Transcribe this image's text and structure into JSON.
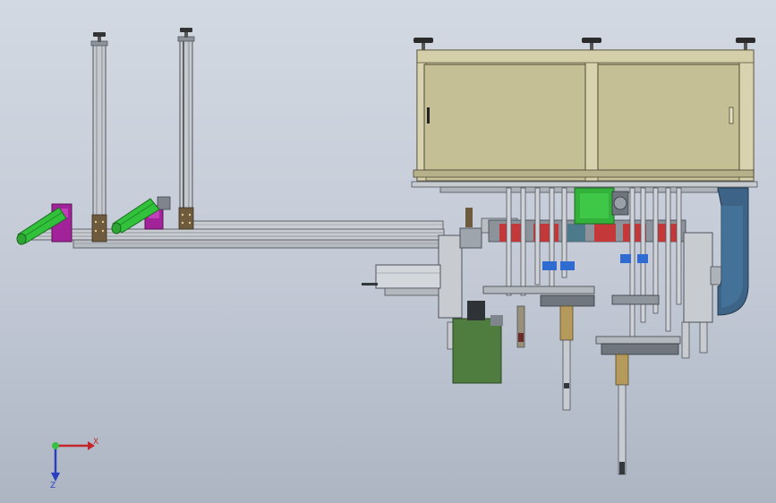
{
  "viewport": {
    "background_top": "#d3d9e2",
    "background_bottom": "#adb5c3"
  },
  "colors": {
    "frame": "#c9cdd2",
    "frame_dark": "#6f757c",
    "cabinet": "#c9c39a",
    "cabinet_dark": "#8a8463",
    "conveyor_green": "#31c13a",
    "magenta_block": "#a2229a",
    "blue_chute": "#3d6486",
    "dark_green_box": "#4f7d3f",
    "red_part": "#c4383a",
    "blue_part": "#2f6bd1",
    "brass": "#b59a5c"
  },
  "components": [
    {
      "name": "left-column-1",
      "icon": "aluminum-profile-column"
    },
    {
      "name": "left-column-2",
      "icon": "aluminum-profile-column"
    },
    {
      "name": "base-rail",
      "icon": "aluminum-profile-rail"
    },
    {
      "name": "green-conveyor-1",
      "icon": "belt-conveyor"
    },
    {
      "name": "green-conveyor-2",
      "icon": "belt-conveyor"
    },
    {
      "name": "electrical-cabinet",
      "icon": "sliding-door-cabinet"
    },
    {
      "name": "blue-chute",
      "icon": "discharge-chute"
    },
    {
      "name": "dark-green-box",
      "icon": "motor-box"
    },
    {
      "name": "horizontal-cylinder",
      "icon": "pneumatic-cylinder"
    }
  ],
  "triad": {
    "x_label": "X",
    "z_label": "Z"
  }
}
